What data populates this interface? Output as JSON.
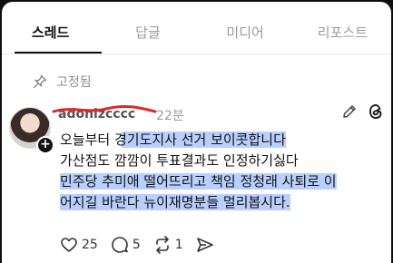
{
  "tabs": [
    {
      "label": "스레드"
    },
    {
      "label": "답글"
    },
    {
      "label": "미디어"
    },
    {
      "label": "리포스트"
    }
  ],
  "pinned": {
    "label": "고정됨",
    "icon": "pin-icon"
  },
  "post": {
    "username": "adonizcccc",
    "time": "22분",
    "lines": [
      "오늘부터 경기도지사 선거 보이콧합니다",
      "가산점도 깜깜이 투표결과도 인정하기싫다",
      "민주당 추미애 떨어뜨리고 책임 정청래 사퇴로 이",
      "어지길 바란다 뉴이재명분들 멀리봅시다."
    ],
    "actions": {
      "like_count": "25",
      "comment_count": "5",
      "repost_count": "1"
    }
  },
  "colors": {
    "highlight": "#b9d0ff",
    "redact": "#e0262b"
  }
}
